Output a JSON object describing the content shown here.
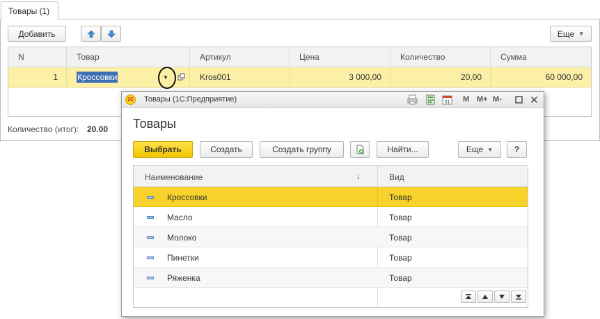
{
  "tab": {
    "label": "Товары (1)"
  },
  "toolbar": {
    "add_label": "Добавить",
    "more_label": "Еще"
  },
  "grid": {
    "columns": [
      "N",
      "Товар",
      "Артикул",
      "Цена",
      "Количество",
      "Сумма"
    ],
    "rows": [
      {
        "n": "1",
        "product": "Кроссовки",
        "article": "Kros001",
        "price": "3 000,00",
        "quantity": "20,00",
        "sum": "60 000,00"
      }
    ]
  },
  "totals": {
    "label": "Количество (итог):",
    "value": "20.00"
  },
  "popup": {
    "window_title": "Товары  (1С:Предприятие)",
    "titlebar_buttons": {
      "m": "M",
      "m_plus": "M+",
      "m_minus": "M-"
    },
    "heading": "Товары",
    "buttons": {
      "choose": "Выбрать",
      "create": "Создать",
      "create_group": "Создать группу",
      "find": "Найти...",
      "more": "Еще",
      "help": "?"
    },
    "list": {
      "columns": [
        "Наименование",
        "Вид"
      ],
      "sort_indicator": "↓",
      "rows": [
        {
          "name": "Кроссовки",
          "kind": "Товар"
        },
        {
          "name": "Масло",
          "kind": "Товар"
        },
        {
          "name": "Молоко",
          "kind": "Товар"
        },
        {
          "name": "Пинетки",
          "kind": "Товар"
        },
        {
          "name": "Ряженка",
          "kind": "Товар"
        }
      ]
    }
  },
  "icons": {
    "up": "arrow-up-icon",
    "down": "arrow-down-icon",
    "dropdown": "chevron-down-icon",
    "open": "open-form-icon",
    "logo": "1c-logo-icon",
    "print": "print-icon",
    "calculator": "calculator-icon",
    "calendar": "calendar-icon",
    "restore": "restore-window-icon",
    "close": "close-icon",
    "list_item": "catalog-item-icon",
    "copy": "copy-icon"
  },
  "colors": {
    "selection_yellow": "#f6d22a",
    "row_highlight": "#fbf0a6",
    "primary_button": "#f2c500",
    "text_selection": "#3d6fb6"
  }
}
